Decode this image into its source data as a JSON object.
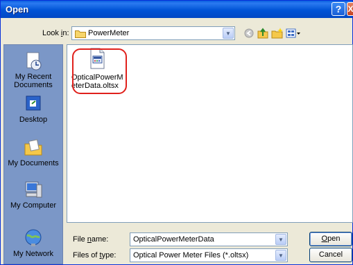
{
  "window": {
    "title": "Open",
    "help_icon": "?",
    "close_icon": "X"
  },
  "lookin": {
    "label_pre": "Look ",
    "label_u": "i",
    "label_post": "n:",
    "value": "PowerMeter"
  },
  "toolbar": {
    "back": "back-icon",
    "up": "up-folder-icon",
    "new_folder": "new-folder-icon",
    "views": "views-icon"
  },
  "places": [
    {
      "label": "My Recent Documents"
    },
    {
      "label": "Desktop"
    },
    {
      "label": "My Documents"
    },
    {
      "label": "My Computer"
    },
    {
      "label": "My Network"
    }
  ],
  "files": [
    {
      "name": "OpticalPowerMeterData.oltsx"
    }
  ],
  "filename": {
    "label_pre": "File ",
    "label_u": "n",
    "label_post": "ame:",
    "value": "OpticalPowerMeterData"
  },
  "filetype": {
    "label_pre": "Files of ",
    "label_u": "t",
    "label_post": "ype:",
    "value": "Optical Power Meter Files (*.oltsx)"
  },
  "buttons": {
    "open_u": "O",
    "open_rest": "pen",
    "cancel": "Cancel"
  },
  "colors": {
    "title_bar": "#0053d6",
    "places_bg": "#7b97c7",
    "dialog_bg": "#ece9d8",
    "highlight": "#e0201b"
  }
}
